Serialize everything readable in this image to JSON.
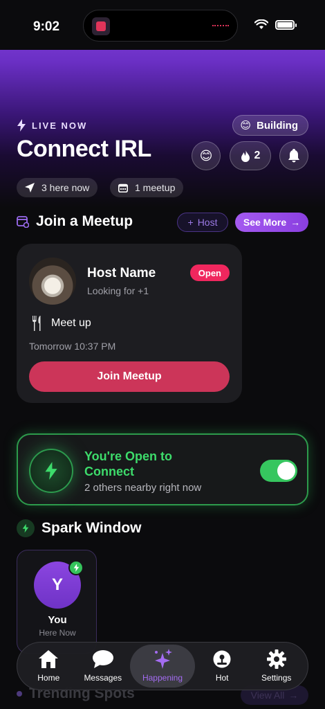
{
  "status_bar": {
    "time": "9:02"
  },
  "header": {
    "live_label": "LIVE NOW",
    "building_chip": "Building",
    "title": "Connect IRL",
    "flame_count": "2",
    "stats": {
      "here_now": "3 here now",
      "meetups": "1 meetup"
    }
  },
  "meetup_section": {
    "title": "Join a Meetup",
    "host_label": "Host",
    "see_more_label": "See More",
    "card": {
      "host_name": "Host Name",
      "looking": "Looking for +1",
      "badge": "Open",
      "activity": "Meet up",
      "when": "Tomorrow 10:37 PM",
      "join_label": "Join Meetup"
    }
  },
  "connect": {
    "title": "You're Open to Connect",
    "subtitle": "2 others nearby right now",
    "toggle_on": true
  },
  "spark": {
    "title": "Spark Window",
    "you": {
      "initial": "Y",
      "name": "You",
      "status": "Here Now"
    }
  },
  "trending": {
    "title": "Trending Spots",
    "view_all": "View All"
  },
  "nav": {
    "items": [
      {
        "label": "Home",
        "icon": "home-icon"
      },
      {
        "label": "Messages",
        "icon": "messages-icon"
      },
      {
        "label": "Happening",
        "icon": "sparkles-icon"
      },
      {
        "label": "Hot",
        "icon": "joystick-icon"
      },
      {
        "label": "Settings",
        "icon": "gear-icon"
      }
    ],
    "active": "Happening"
  },
  "colors": {
    "accent": "#a46cf2",
    "green": "#36c65f",
    "pink": "#cc3559",
    "open_badge": "#f0275e"
  }
}
